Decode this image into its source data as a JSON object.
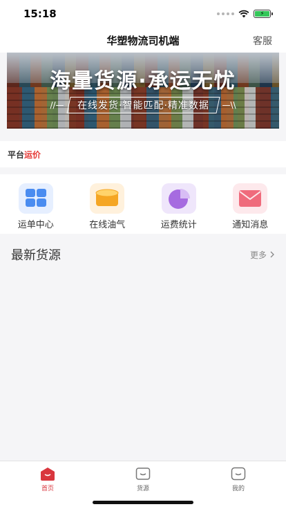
{
  "status_bar": {
    "time": "15:18",
    "battery_level_fraction": 1.0,
    "icons": [
      "signal-dots-icon",
      "wifi-icon",
      "battery-charging-icon"
    ]
  },
  "nav": {
    "title": "华塑物流司机端",
    "action_label": "客服"
  },
  "banner": {
    "headline": "海量货源·承运无忧",
    "subline": "在线发货·智能匹配·精准数据",
    "slash_left": "//—",
    "slash_right": "—\\\\"
  },
  "platform": {
    "label_prefix": "平台",
    "label_highlight": "运价",
    "highlight_color": "#e53935"
  },
  "quick_menu": [
    {
      "label": "运单中心",
      "icon": "grid-icon",
      "color": "#4a8cf0"
    },
    {
      "label": "在线油气",
      "icon": "fuel-tank-icon",
      "color": "#f5a623"
    },
    {
      "label": "运费统计",
      "icon": "pie-chart-icon",
      "color": "#a66be0"
    },
    {
      "label": "通知消息",
      "icon": "envelope-icon",
      "color": "#ef6b7c"
    }
  ],
  "section": {
    "title": "最新货源",
    "more_label": "更多"
  },
  "tabs": [
    {
      "label": "首页",
      "icon": "home-icon",
      "active": true
    },
    {
      "label": "货源",
      "icon": "cargo-icon",
      "active": false
    },
    {
      "label": "我的",
      "icon": "profile-icon",
      "active": false
    }
  ],
  "accent_color": "#d9363e"
}
